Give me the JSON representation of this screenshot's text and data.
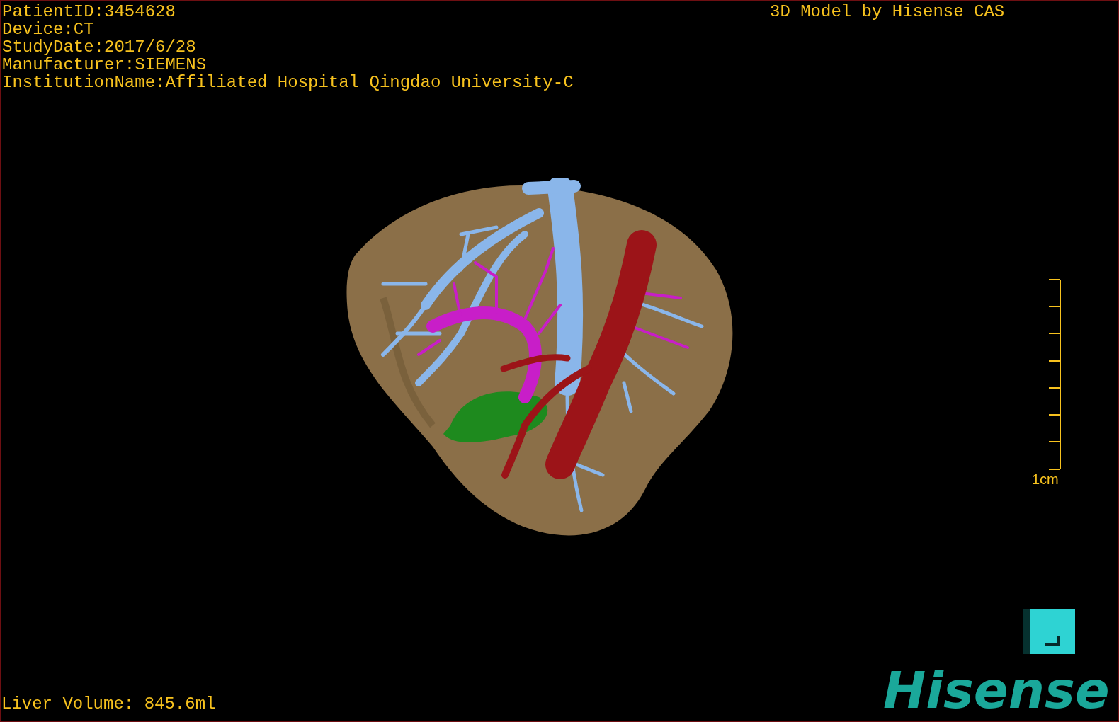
{
  "info_lines": [
    "PatientID:3454628",
    "Device:CT",
    "StudyDate:2017/6/28",
    "Manufacturer:SIEMENS",
    "InstitutionName:Affiliated Hospital Qingdao University-C"
  ],
  "title": "3D Model by Hisense CAS",
  "scale_bar": {
    "label": "1cm"
  },
  "volume": "Liver Volume: 845.6ml",
  "logo": "Hisense"
}
